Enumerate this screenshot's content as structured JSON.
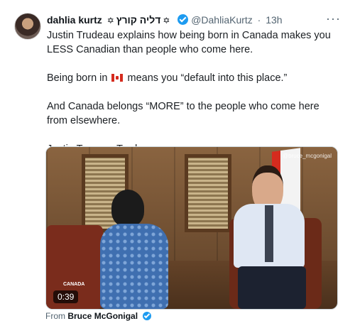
{
  "tweet": {
    "author_name": "dahlia kurtz",
    "author_star": "✡",
    "author_hebrew": "דליה קורץ",
    "author_star2": "✡",
    "handle": "@DahliaKurtz",
    "time": "13h",
    "more_label": "···",
    "paragraphs": [
      "Justin Trudeau explains how being born in Canada makes you LESS Canadian than people who come here.",
      "means you “default into this place.”",
      "And Canada belongs “MORE” to the people who come here from elsewhere.",
      "Justin Treason Trudeau."
    ],
    "born_prefix": "Being born in",
    "flag_icon": "canada-flag-emoji"
  },
  "media": {
    "duration": "0:39",
    "watermark": "@bruce_mcgonigal",
    "corner_logo": "CANADA"
  },
  "from": {
    "prefix": "From",
    "name": "Bruce McGonigal"
  },
  "colors": {
    "verified": "#1d9bf0",
    "secondary_text": "#536471"
  }
}
